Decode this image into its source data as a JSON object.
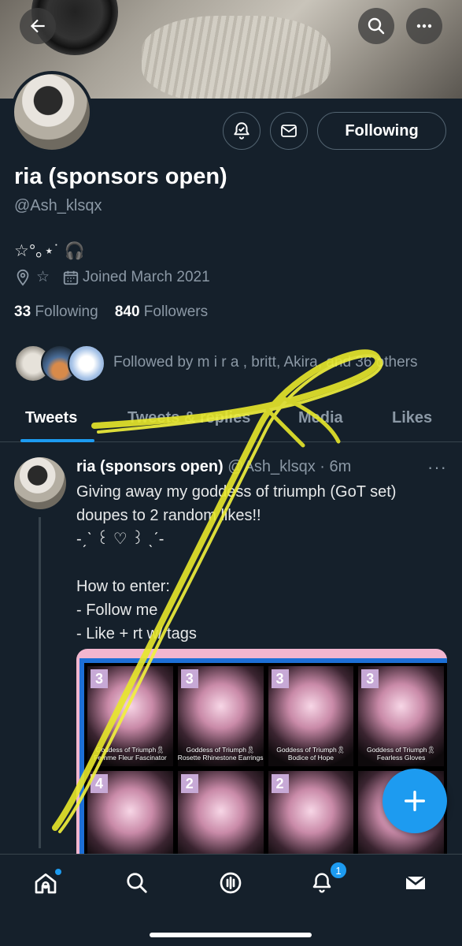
{
  "profile": {
    "name": "ria (sponsors open)",
    "handle": "@Ash_klsqx",
    "bio": "☆°｡⋆˙ 🎧",
    "location": "☆",
    "joined": "Joined March 2021",
    "following_count": "33",
    "following_label": "Following",
    "followers_count": "840",
    "followers_label": "Followers",
    "followed_by": "Followed by m i r a , britt, Akira, and 36 others",
    "follow_button_label": "Following"
  },
  "tabs": [
    {
      "label": "Tweets",
      "active": true
    },
    {
      "label": "Tweets & replies",
      "active": false
    },
    {
      "label": "Media",
      "active": false
    },
    {
      "label": "Likes",
      "active": false
    }
  ],
  "tweet": {
    "author": "ria (sponsors open)",
    "handle_time": "@Ash_klsqx · 6m",
    "more": "···",
    "text": "Giving away my goddess of triumph (GoT set) doupes to 2 random likes!!\n-ˏˋ ꒰ ♡ ꒱ ˎˊ-\n\nHow to enter:\n- Follow me\n- Like + rt w/ tags",
    "media_cards": [
      {
        "count": "3",
        "label": "Goddess of Triumph🎗Femme Fleur Fascinator"
      },
      {
        "count": "3",
        "label": "Goddess of Triumph🎗Rosette Rhinestone Earrings"
      },
      {
        "count": "3",
        "label": "Goddess of Triumph🎗Bodice of Hope"
      },
      {
        "count": "3",
        "label": "Goddess of Triumph🎗Fearless Gloves"
      },
      {
        "count": "4",
        "label": ""
      },
      {
        "count": "2",
        "label": ""
      },
      {
        "count": "2",
        "label": ""
      },
      {
        "count": "",
        "label": ""
      }
    ]
  },
  "nav": {
    "notifications_badge": "1"
  },
  "colors": {
    "background": "#15202b",
    "accent": "#1d9bf0",
    "muted": "#8b98a5",
    "scribble": "#e8e82a"
  },
  "icons": [
    "back-arrow-icon",
    "search-icon",
    "more-icon",
    "bell-plus-icon",
    "mail-icon",
    "location-icon",
    "calendar-icon",
    "home-icon",
    "spaces-icon",
    "bell-icon",
    "inbox-icon",
    "compose-plus-icon"
  ]
}
